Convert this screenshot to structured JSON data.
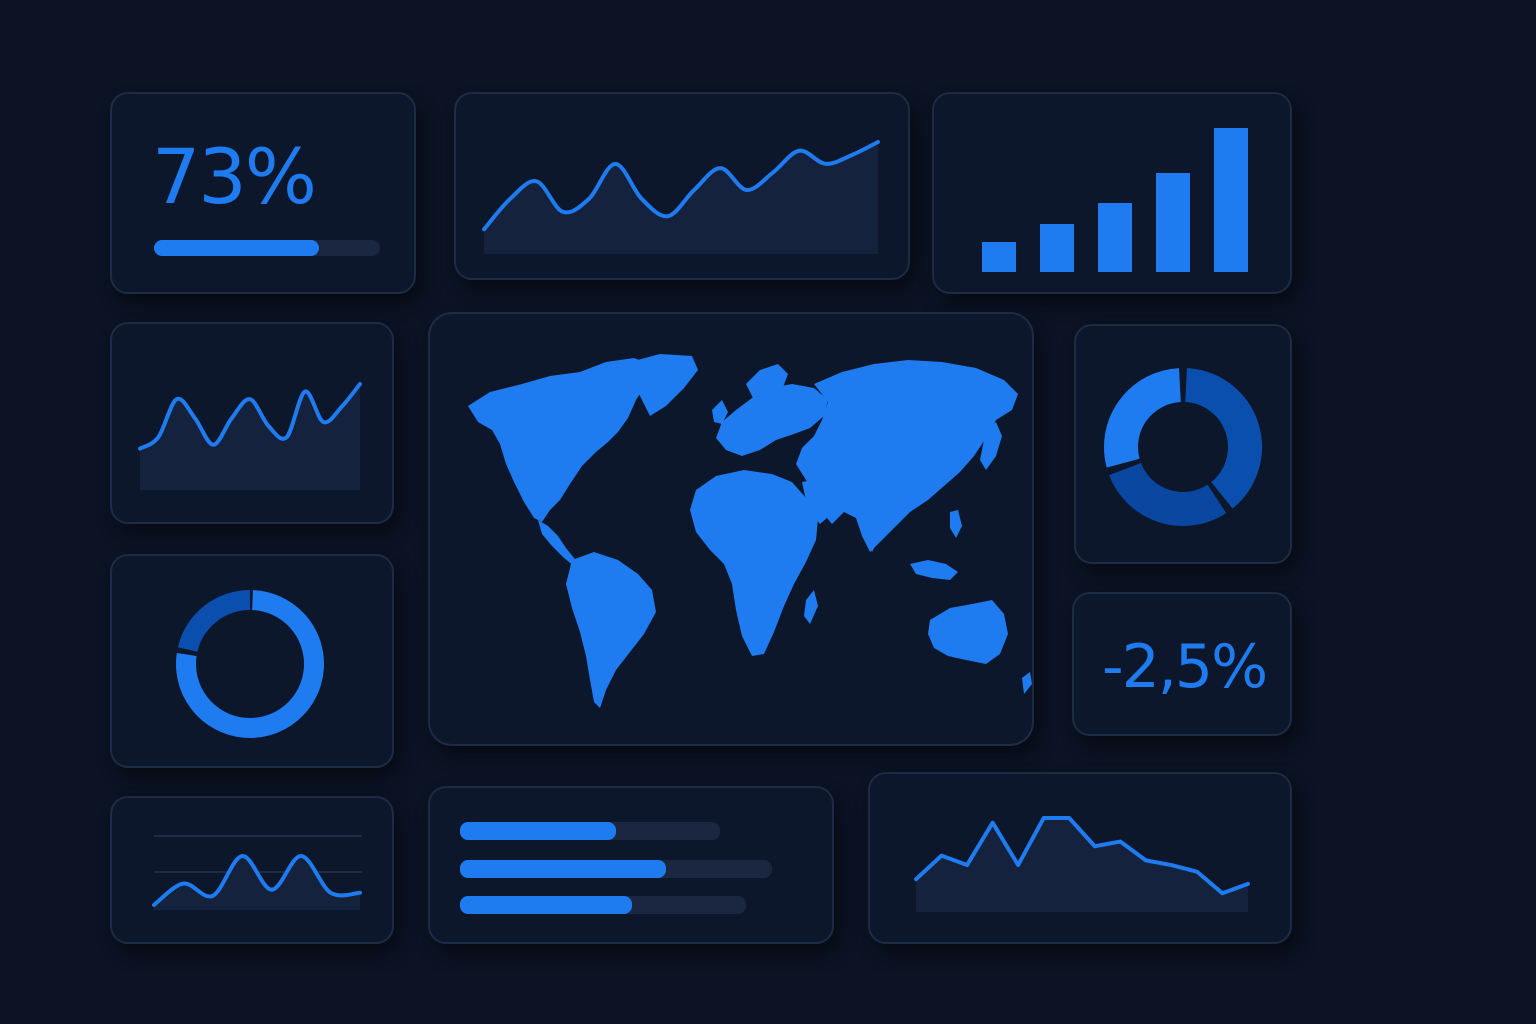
{
  "colors": {
    "background": "#0b1324",
    "panel": "#0d172b",
    "border": "#1d2b45",
    "accent": "#1f7bf0",
    "accent_dark": "#0b4fae",
    "track": "#1b2740"
  },
  "kpi_top": {
    "value": "73%",
    "progress": 0.73
  },
  "kpi_bottom": {
    "value": "-2,5%"
  },
  "top_line_chart": {
    "type": "area",
    "points": [
      0.1,
      0.45,
      0.65,
      0.3,
      0.45,
      0.85,
      0.45,
      0.25,
      0.55,
      0.8,
      0.55,
      0.75,
      1.0,
      0.85,
      0.95,
      1.1
    ]
  },
  "bar_chart": {
    "type": "bar",
    "values": [
      1,
      1.6,
      2.3,
      3.3,
      4.8
    ]
  },
  "left_line_chart": {
    "type": "area",
    "points": [
      0.15,
      0.3,
      0.8,
      0.55,
      0.2,
      0.55,
      0.8,
      0.45,
      0.3,
      0.9,
      0.5,
      0.7,
      1.0
    ]
  },
  "map": {
    "icon": "world-map-icon"
  },
  "donut_right": {
    "segments": [
      0.4,
      0.3,
      0.3
    ]
  },
  "donut_left": {
    "fill": 0.78
  },
  "bottom_left_chart": {
    "type": "area",
    "points": [
      0.05,
      0.4,
      0.2,
      0.85,
      0.3,
      0.85,
      0.25,
      0.25
    ]
  },
  "hbars": {
    "items": [
      0.6,
      0.66,
      0.6
    ],
    "track_widths": [
      1.0,
      1.2,
      1.1
    ]
  },
  "bottom_right_chart": {
    "type": "area",
    "points": [
      0.2,
      0.45,
      0.35,
      0.8,
      0.35,
      0.85,
      0.85,
      0.55,
      0.6,
      0.4,
      0.35,
      0.28,
      0.05,
      0.15
    ]
  }
}
